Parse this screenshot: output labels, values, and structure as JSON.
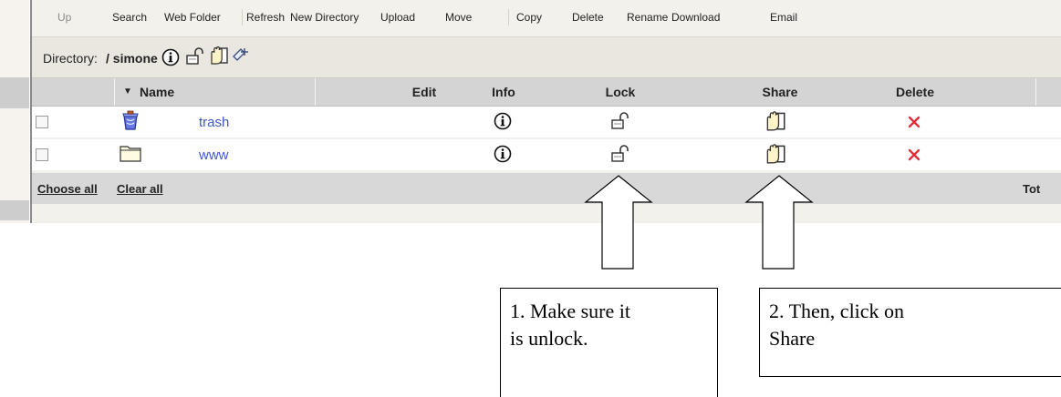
{
  "toolbar": {
    "up": "Up",
    "search": "Search",
    "web_folder": "Web Folder",
    "refresh": "Refresh",
    "new_directory": "New Directory",
    "upload": "Upload",
    "move": "Move",
    "copy": "Copy",
    "delete": "Delete",
    "rename": "Rename",
    "download": "Download",
    "email": "Email"
  },
  "directory": {
    "label": "Directory:",
    "path": "/ simone",
    "icons": [
      "info-icon",
      "lock-icon",
      "share-hand-icon",
      "bookmark-icon"
    ]
  },
  "table": {
    "columns": [
      "Name",
      "Edit",
      "Info",
      "Lock",
      "Share",
      "Delete"
    ],
    "sort_indicator": "▼",
    "rows": [
      {
        "name": "trash",
        "type_icon": "trash-icon",
        "info_icon": "info-icon",
        "lock_icon": "lock-open-icon",
        "share_icon": "share-hand-icon",
        "delete_icon": "delete-x-icon"
      },
      {
        "name": "www",
        "type_icon": "folder-icon",
        "info_icon": "info-icon",
        "lock_icon": "lock-open-icon",
        "share_icon": "share-hand-icon",
        "delete_icon": "delete-x-icon"
      }
    ]
  },
  "footer": {
    "choose_all": "Choose all",
    "clear_all": "Clear all",
    "total": "Tot"
  },
  "annotations": {
    "note1": "1. Make sure it\nis unlock.",
    "note2": "2. Then, click on\nShare"
  },
  "colors": {
    "link": "#3e57d0",
    "delete": "#e0303a",
    "header_bg": "#d4d4d4",
    "toolbar_bg": "#f3f1ec"
  }
}
